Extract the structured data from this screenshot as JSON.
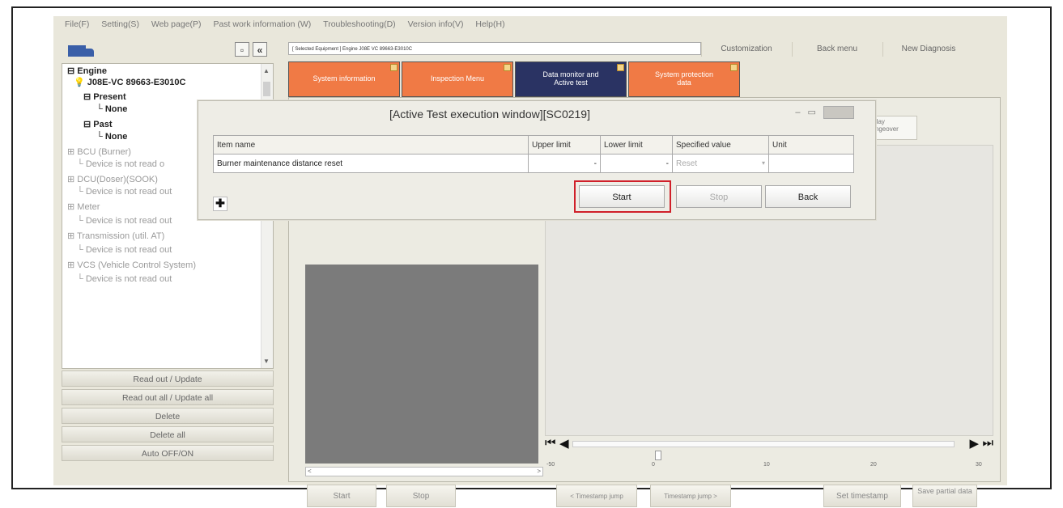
{
  "menu": [
    "File(F)",
    "Setting(S)",
    "Web page(P)",
    "Past work information (W)",
    "Troubleshooting(D)",
    "Version info(V)",
    "Help(H)"
  ],
  "header": {
    "title_field": "[ Selected Equipment ] Engine  J08E VC 89663-E3010C",
    "customization": "Customization",
    "back_menu": "Back menu",
    "new_diagnosis": "New Diagnosis"
  },
  "tabs": [
    {
      "label": "System information",
      "color": "#f07a45"
    },
    {
      "label": "Inspection Menu",
      "color": "#f07a45"
    },
    {
      "label": "Data monitor and Active test",
      "color": "#2a3363"
    },
    {
      "label": "System protection data",
      "color": "#f07a45"
    }
  ],
  "tree": {
    "engine": "Engine",
    "ecu": "J08E-VC 89663-E3010C",
    "present": "Present",
    "present_none": "None",
    "past": "Past",
    "past_none": "None",
    "bcu": "BCU (Burner)",
    "bcu_status": "Device is not read o",
    "dcu": "DCU(Doser)(SOOK)",
    "dcu_status": "Device is not read out",
    "meter": "Meter",
    "meter_status": "Device is not read out",
    "trans": "Transmission (util. AT)",
    "trans_status": "Device is not read out",
    "vcs": "VCS (Vehicle Control System)",
    "vcs_status": "Device is not read out"
  },
  "left_buttons": [
    "Read out / Update",
    "Read out all / Update all",
    "Delete",
    "Delete all",
    "Auto OFF/ON"
  ],
  "mini_tab": {
    "line1": "display",
    "line2": "changeover"
  },
  "ticks": [
    "-50",
    "0",
    "10",
    "20",
    "30"
  ],
  "bottom_buttons": {
    "start": "Start",
    "stop": "Stop",
    "ts_back": "< Timestamp jump",
    "ts_fwd": "Timestamp jump >",
    "set_ts": "Set timestamp",
    "save_partial": "Save partial data"
  },
  "dialog": {
    "title": "[Active Test execution window][SC0219]",
    "columns": [
      "Item name",
      "Upper limit",
      "Lower limit",
      "Specified value",
      "Unit"
    ],
    "row": {
      "item": "Burner maintenance distance reset",
      "upper": "-",
      "lower": "-",
      "specified": "Reset",
      "unit": ""
    },
    "start": "Start",
    "stop": "Stop",
    "back": "Back"
  }
}
